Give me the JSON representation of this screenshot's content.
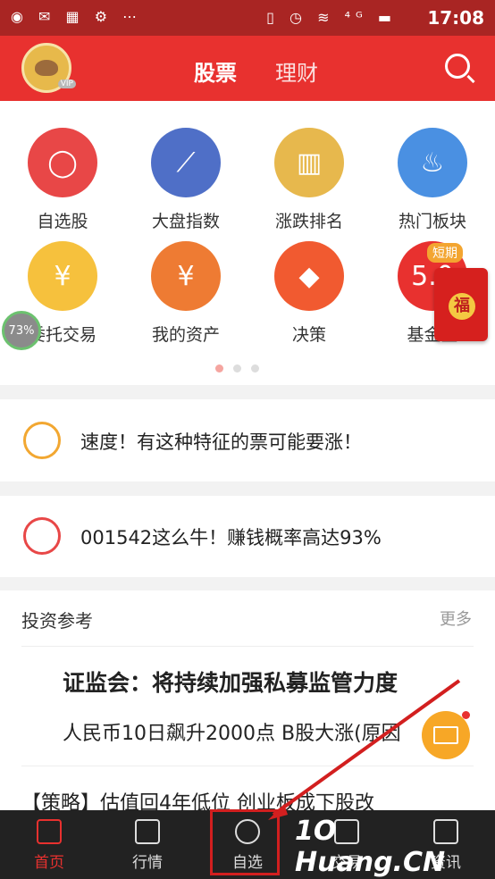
{
  "status_bar": {
    "time": "17:08",
    "left_icons": "◉ ✉ ▦ ⚙ ⋯",
    "right_icons": "▯ ◷ ≋ ⁴ᴳ ▬"
  },
  "header": {
    "tabs": [
      "股票",
      "理财"
    ],
    "vip": "VIP"
  },
  "grid": {
    "items": [
      {
        "label": "自选股",
        "color": "#e84747",
        "glyph": "◯"
      },
      {
        "label": "大盘指数",
        "color": "#4f6fc7",
        "glyph": "⟋"
      },
      {
        "label": "涨跌排名",
        "color": "#e7b84d",
        "glyph": "▥"
      },
      {
        "label": "热门板块",
        "color": "#4a90e2",
        "glyph": "♨"
      },
      {
        "label": "委托交易",
        "color": "#f6c13d",
        "glyph": "¥"
      },
      {
        "label": "我的资产",
        "color": "#ee7b33",
        "glyph": "¥"
      },
      {
        "label": "决策",
        "color": "#f15a30",
        "glyph": "◆"
      },
      {
        "label": "基金宝",
        "color": "#e8312f",
        "glyph": "5.0"
      }
    ],
    "short_tag": "短期",
    "badge": "73%",
    "lucky": "福"
  },
  "news": [
    {
      "text": "速度！有这种特征的票可能要涨！",
      "icon_color": "#f2a731"
    },
    {
      "text": "001542这么牛！赚钱概率高达93%",
      "icon_color": "#e84747"
    }
  ],
  "invest": {
    "title": "投资参考",
    "more": "更多",
    "headline": "证监会：将持续加强私募监管力度",
    "sub": "人民币10日飙升2000点 B股大涨(原因",
    "third": "【策略】估值回4年低位 创业板成下股改"
  },
  "tabbar": {
    "items": [
      "首页",
      "行情",
      "自选",
      "交易",
      "资讯"
    ],
    "active": 0
  },
  "watermark": "1O Huang.CN"
}
